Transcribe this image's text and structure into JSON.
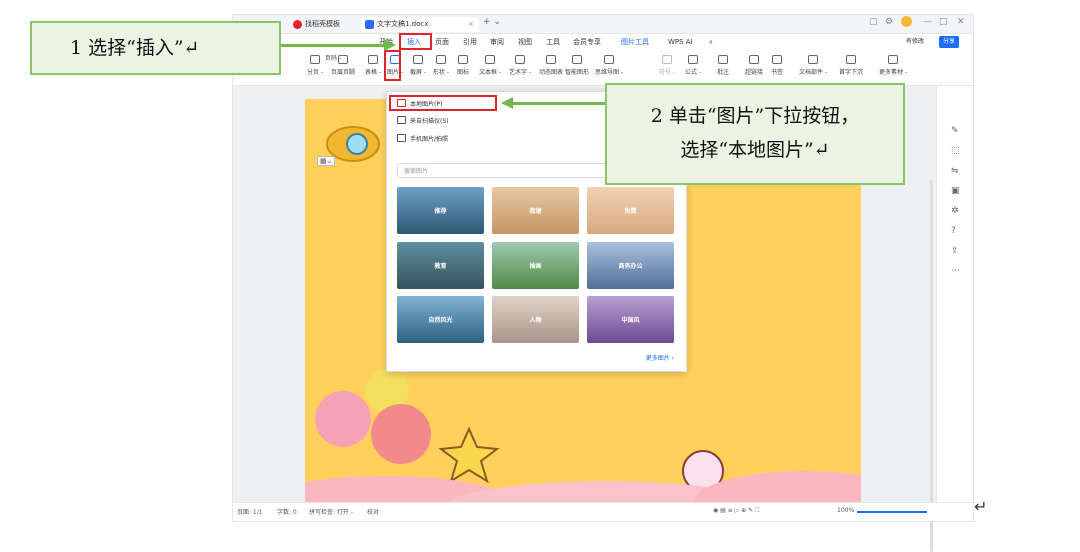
{
  "window": {
    "tabs": [
      {
        "label": "找稻壳模板",
        "color": "#e0242a"
      },
      {
        "label": "文字文稿1.docx",
        "color": "#2f6bff"
      }
    ],
    "tab_close": "×",
    "new_tab": "+ ⌄",
    "controls": [
      "▢",
      "⚙",
      "—",
      "□",
      "✕"
    ]
  },
  "menubar": {
    "items": [
      "开始",
      "插入",
      "页面",
      "引用",
      "审阅",
      "视图",
      "工具",
      "会员专享",
      "图片工具",
      "WPS AI"
    ],
    "selected": "插入",
    "right": [
      "有修改",
      "分享"
    ]
  },
  "ribbon": {
    "items": [
      {
        "label": "分页 -"
      },
      {
        "label": "页眉页脚"
      },
      {
        "label": "表格 -"
      },
      {
        "label": "图片 -"
      },
      {
        "label": "截屏 -"
      },
      {
        "label": "形状 -"
      },
      {
        "label": "图标"
      },
      {
        "label": "文本框 -"
      },
      {
        "label": "艺术字 -"
      },
      {
        "label": "动态图表"
      },
      {
        "label": "智能图形"
      },
      {
        "label": "思维导图 -"
      },
      {
        "label": "符号 -"
      },
      {
        "label": "公式 -"
      },
      {
        "label": "批注"
      },
      {
        "label": "超链接"
      },
      {
        "label": "书签"
      },
      {
        "label": "文档部件 -"
      },
      {
        "label": "首字下沉"
      },
      {
        "label": "更多素材 -"
      }
    ],
    "upper": [
      "页码 -",
      "图表",
      "流程图 -",
      "附件 -"
    ]
  },
  "dropdown": {
    "items": [
      "本地图片(P)",
      "来自扫描仪(S)",
      "手机图片/拍照"
    ],
    "search_placeholder": "搜索图片",
    "categories": [
      "推荐",
      "荷塘",
      "免费",
      "教育",
      "插画",
      "商务办公",
      "自然风光",
      "人物",
      "中国风"
    ],
    "more": "更多图片 ›"
  },
  "statusbar": {
    "page": "页面: 1/1",
    "words": "字数: 0",
    "spell": "拼写检查: 打开 -",
    "proof": "校对",
    "zoom": "100%"
  },
  "callouts": {
    "step1": "1 选择“插入”↵",
    "step2_line1": "2 单击“图片”下拉按钮，",
    "step2_line2": "选择“本地图片”↵"
  },
  "colors": {
    "accent": "#1e6bff",
    "highlight": "#e0242a",
    "callout_border": "#8cc36a",
    "page": "#ffd15c"
  }
}
